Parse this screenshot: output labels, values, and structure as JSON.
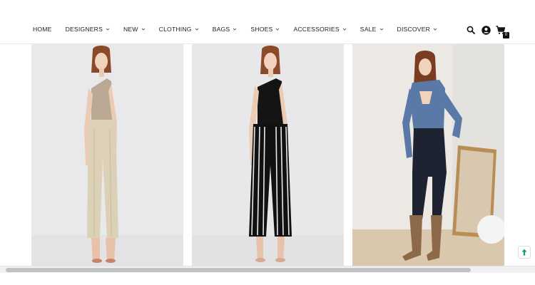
{
  "nav": {
    "items": [
      {
        "label": "HOME",
        "dropdown": false
      },
      {
        "label": "DESIGNERS",
        "dropdown": true
      },
      {
        "label": "NEW",
        "dropdown": true
      },
      {
        "label": "CLOTHING",
        "dropdown": true
      },
      {
        "label": "BAGS",
        "dropdown": true
      },
      {
        "label": "SHOES",
        "dropdown": true
      },
      {
        "label": "ACCESSORIES",
        "dropdown": true
      },
      {
        "label": "SALE",
        "dropdown": true
      },
      {
        "label": "DISCOVER",
        "dropdown": true
      }
    ]
  },
  "header_actions": {
    "search_icon": "search-icon",
    "account_icon": "account-icon",
    "cart_icon": "cart-icon",
    "cart_count": "0"
  },
  "products": [
    {
      "image": "model-in-beige-one-shoulder-knit-top-and-cream-trousers",
      "background": "#e9e9eb"
    },
    {
      "image": "model-in-black-one-shoulder-top-and-striped-wide-leg-trousers",
      "background": "#e8e8ea"
    },
    {
      "image": "model-in-blue-cutout-knit-top-jeans-and-tan-boots",
      "background": "#ece9e4"
    }
  ],
  "colors": {
    "text": "#222222",
    "border": "#e6e6e6",
    "scroll_thumb": "#c2c2c2",
    "scroll_top_accent": "#1a9e5b"
  }
}
